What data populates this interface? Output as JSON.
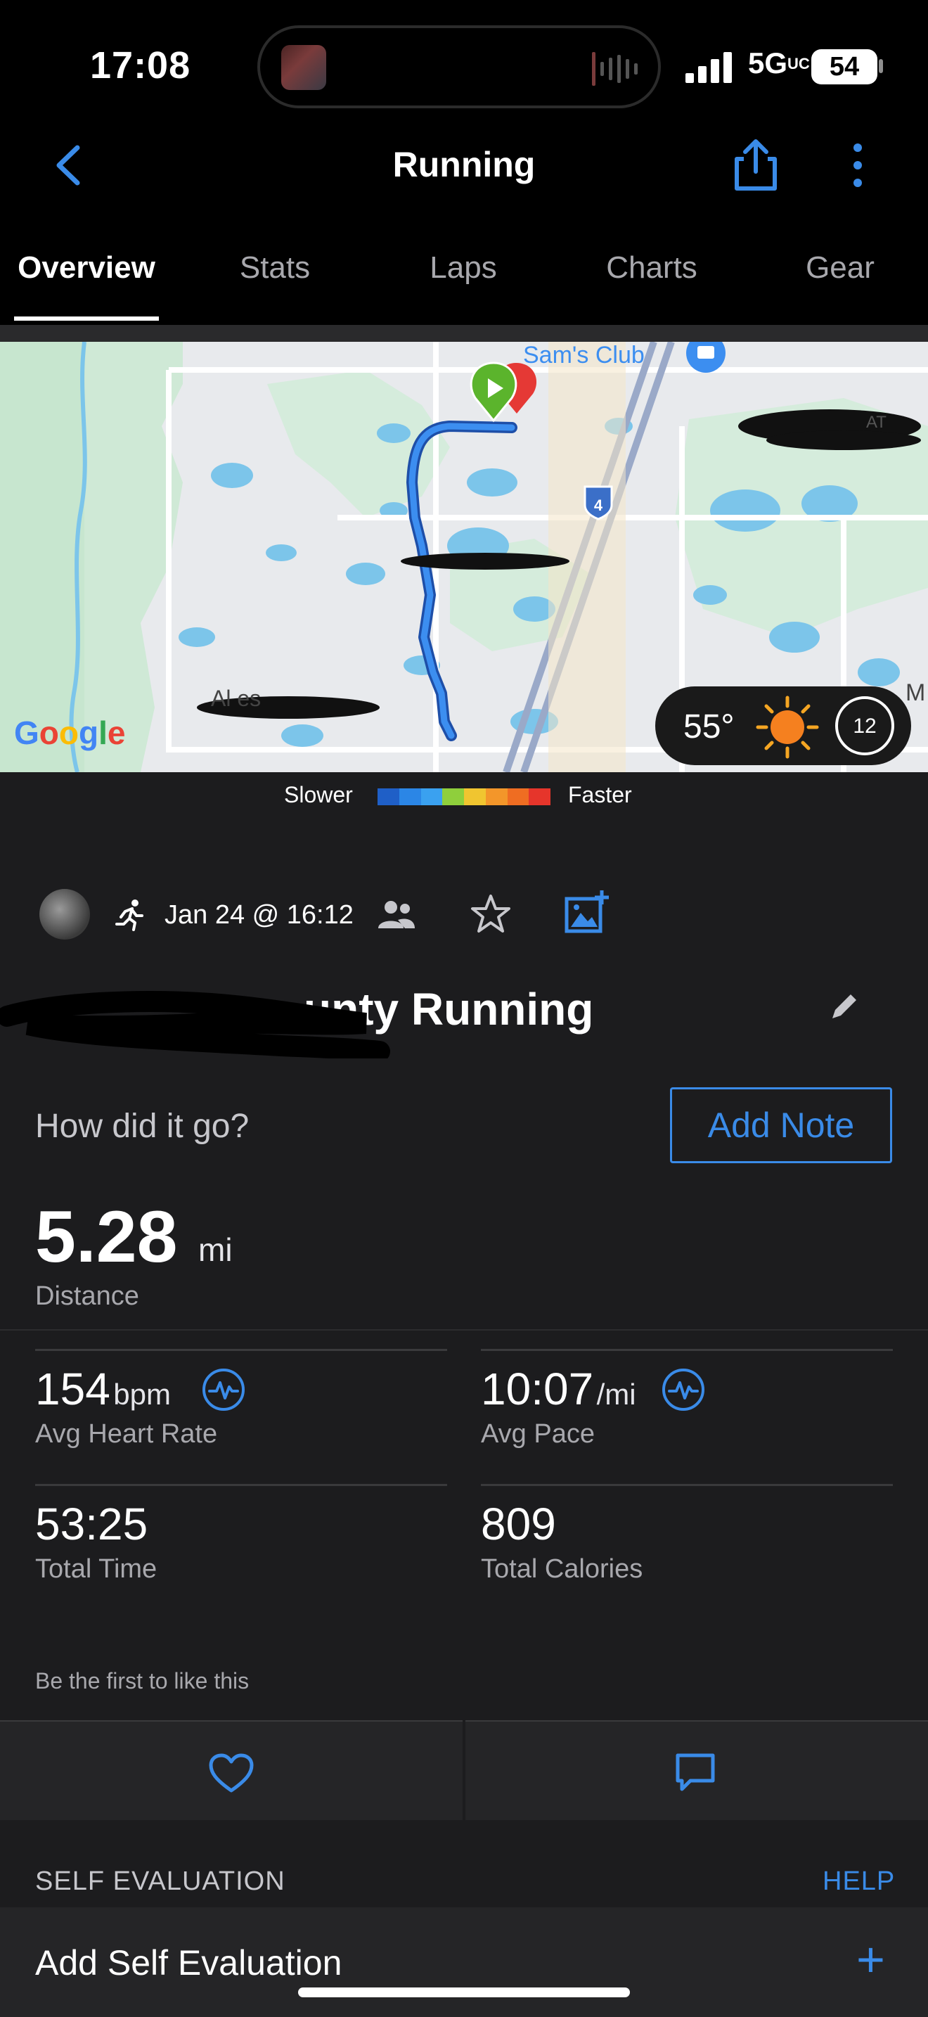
{
  "status_bar": {
    "time": "17:08",
    "network": "5G",
    "network_suffix": "UC",
    "battery": "54"
  },
  "nav": {
    "title": "Running"
  },
  "tabs": [
    {
      "label": "Overview",
      "active": true
    },
    {
      "label": "Stats"
    },
    {
      "label": "Laps"
    },
    {
      "label": "Charts"
    },
    {
      "label": "Gear"
    }
  ],
  "map": {
    "poi_sams_club": "Sam's Club",
    "highway_shield": "4",
    "label_at": "AT",
    "label_m": "M",
    "label_partial": "Al                es",
    "google": [
      "G",
      "o",
      "o",
      "g",
      "l",
      "e"
    ],
    "google_colors": [
      "#4285F4",
      "#EA4335",
      "#FBBC05",
      "#4285F4",
      "#34A853",
      "#EA4335"
    ],
    "weather_temp": "55°",
    "wind_value": "12"
  },
  "legend": {
    "slower": "Slower",
    "faster": "Faster",
    "colors": [
      "#1f5fc7",
      "#2b86e6",
      "#3aa1f0",
      "#8fcf3c",
      "#f0c530",
      "#f3962a",
      "#ef6d22",
      "#e6352b"
    ]
  },
  "activity": {
    "date": "Jan 24 @ 16:12",
    "name_visible": "unty Running"
  },
  "feedback": {
    "question": "How did it go?",
    "add_note": "Add Note"
  },
  "distance": {
    "value": "5.28",
    "unit": "mi",
    "label": "Distance"
  },
  "stats": {
    "hr": {
      "value": "154",
      "unit": "bpm",
      "label": "Avg Heart Rate"
    },
    "pace": {
      "value": "10:07",
      "unit": "/mi",
      "label": "Avg Pace"
    },
    "time": {
      "value": "53:25",
      "label": "Total Time"
    },
    "calories": {
      "value": "809",
      "label": "Total Calories"
    }
  },
  "social": {
    "likes_text": "Be the first to like this"
  },
  "self_eval": {
    "title": "SELF EVALUATION",
    "help": "HELP",
    "add_label": "Add Self Evaluation",
    "add_icon": "+"
  },
  "colors": {
    "accent": "#3a8be8",
    "background": "#1c1c1e",
    "start_marker": "#5bb42c",
    "end_marker": "#e53935",
    "route": "#2f6fd6"
  }
}
